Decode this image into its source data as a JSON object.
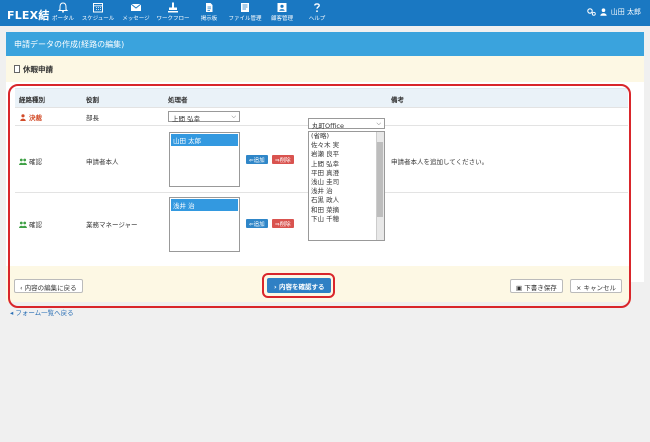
{
  "app": {
    "logo": "FLEX結",
    "nav": [
      {
        "label": "ポータル",
        "icon": "bell-icon"
      },
      {
        "label": "スケジュール",
        "icon": "calendar-icon"
      },
      {
        "label": "メッセージ",
        "icon": "mail-icon"
      },
      {
        "label": "ワークフロー",
        "icon": "workflow-icon"
      },
      {
        "label": "掲示板",
        "icon": "board-icon"
      },
      {
        "label": "ファイル管理",
        "icon": "file-icon"
      },
      {
        "label": "顧客管理",
        "icon": "customer-icon"
      },
      {
        "label": "ヘルプ",
        "icon": "help-icon"
      }
    ],
    "user_name": "山田 太郎"
  },
  "page": {
    "title": "申請データの作成(経路の編集)",
    "form_name": "休暇申請"
  },
  "table": {
    "headers": {
      "route": "経路種別",
      "role": "役割",
      "handler": "処理者",
      "note": "備考"
    },
    "rows": [
      {
        "route": "決裁",
        "role": "部長",
        "handler_select": "上間 弘幸",
        "note": ""
      },
      {
        "route": "確認",
        "role": "申請者本人",
        "handler_list": "山田 太郎",
        "add": "追加",
        "remove": "削除",
        "note": "申請者本人を追加してください。"
      },
      {
        "route": "確認",
        "role": "業務マネージャー",
        "handler_list": "浅井 治",
        "add": "追加",
        "remove": "削除",
        "note": ""
      }
    ],
    "office_select": "丸町Office",
    "candidates": [
      "(省略)",
      "佐々木 実",
      "岩瀬 良平",
      "上間 弘幸",
      "平田 真澄",
      "浅山 圭司",
      "浅井 治",
      "石黒 政人",
      "和田 菜摘",
      "下山 千穂"
    ]
  },
  "actions": {
    "back_edit": "内容の編集に戻る",
    "confirm": "内容を確認する",
    "save_draft": "下書き保存",
    "cancel": "キャンセル"
  },
  "footer": {
    "back_to_forms": "フォーム一覧へ戻る"
  },
  "colors": {
    "topbar": "#1a78c2",
    "panel_header": "#3aa3dd",
    "highlight_ring": "#d9262b",
    "primary_button": "#2f80c4",
    "delete_button": "#d9534f"
  }
}
